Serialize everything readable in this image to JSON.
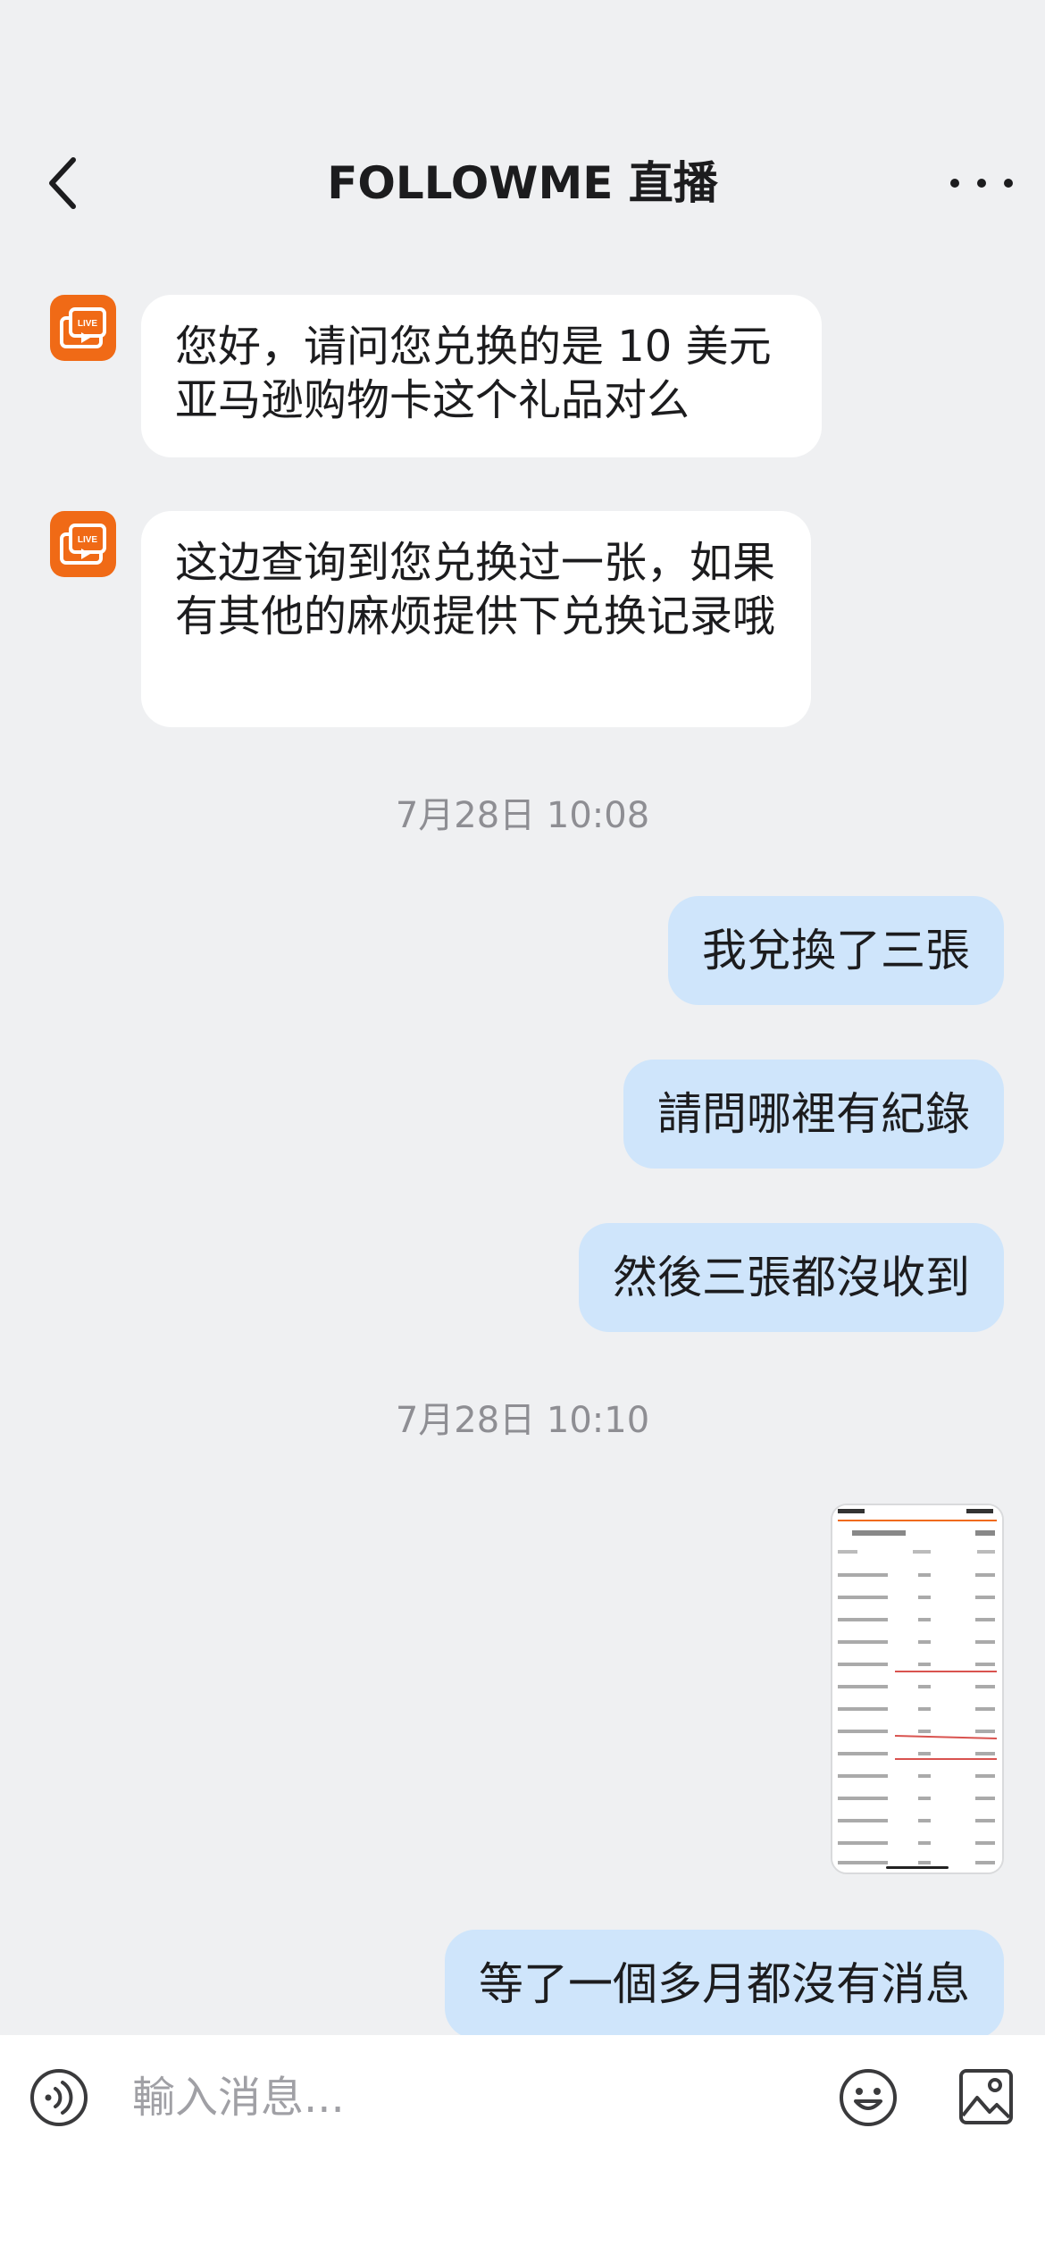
{
  "header": {
    "title": "FOLLOWME 直播"
  },
  "messages_in": [
    {
      "text": "您好，请问您兑换的是 10 美元亚马逊购物卡这个礼品对么"
    },
    {
      "text": "这边查询到您兑换过一张，如果有其他的麻烦提供下兑换记录哦"
    }
  ],
  "timestamps": [
    "7月28日 10:08",
    "7月28日 10:10"
  ],
  "messages_out": [
    {
      "text": "我兌換了三張"
    },
    {
      "text": "請問哪裡有紀錄"
    },
    {
      "text": "然後三張都沒收到"
    },
    {
      "text": "等了一個多月都沒有消息"
    }
  ],
  "input": {
    "placeholder": "輸入消息..."
  },
  "colors": {
    "background": "#eff0f2",
    "bubble_in": "#ffffff",
    "bubble_out": "#cfe5fb",
    "avatar": "#f06a16"
  },
  "icons": {
    "back": "chevron-left-icon",
    "more": "more-dots-icon",
    "avatar": "live-tv-icon",
    "voice": "voice-icon",
    "emoji": "smiley-icon",
    "image": "image-icon"
  }
}
